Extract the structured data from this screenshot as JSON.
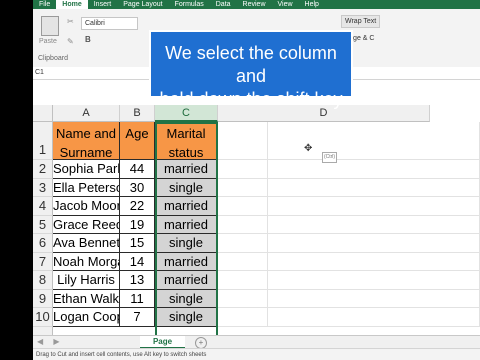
{
  "ribbon": {
    "tabs": [
      "File",
      "Home",
      "Insert",
      "Page Layout",
      "Formulas",
      "Data",
      "Review",
      "View",
      "Help"
    ],
    "active_tab": "Home",
    "paste_label": "Paste",
    "font_name": "Calibri",
    "bold_label": "B",
    "clipboard_label": "Clipboard",
    "wrap_text_label": "Wrap Text",
    "merge_label": "Merge & C"
  },
  "name_box": "C1",
  "caption": {
    "line1": "We select the column and",
    "line2": "hold down the shift key"
  },
  "columns": [
    "A",
    "B",
    "C",
    "D"
  ],
  "rows": [
    "1",
    "2",
    "3",
    "4",
    "5",
    "6",
    "7",
    "8",
    "9",
    "10"
  ],
  "table": {
    "headers": {
      "name": "Name and Surname",
      "age": "Age",
      "marital": "Marital status"
    },
    "records": [
      {
        "name": "Sophia Parker",
        "age": "44",
        "marital": "married"
      },
      {
        "name": "Ella Peterson",
        "age": "30",
        "marital": "single"
      },
      {
        "name": "Jacob Moore",
        "age": "22",
        "marital": "married"
      },
      {
        "name": "Grace Reed",
        "age": "19",
        "marital": "married"
      },
      {
        "name": "Ava Bennett",
        "age": "15",
        "marital": "single"
      },
      {
        "name": "Noah Morgan",
        "age": "14",
        "marital": "married"
      },
      {
        "name": "Lily Harris",
        "age": "13",
        "marital": "married"
      },
      {
        "name": "Ethan Walker",
        "age": "11",
        "marital": "single"
      },
      {
        "name": "Logan Cooper",
        "age": "7",
        "marital": "single"
      }
    ]
  },
  "sheet_tab": "Page",
  "add_sheet_label": "+",
  "paste_options_label": "(Ctrl)",
  "status_text": "Drag to Cut and insert cell contents, use Alt key to switch sheets",
  "colors": {
    "excel_green": "#217346",
    "header_fill": "#f79646",
    "selected_column_fill": "#d4d4d4",
    "callout_blue": "#1f6fd1"
  }
}
